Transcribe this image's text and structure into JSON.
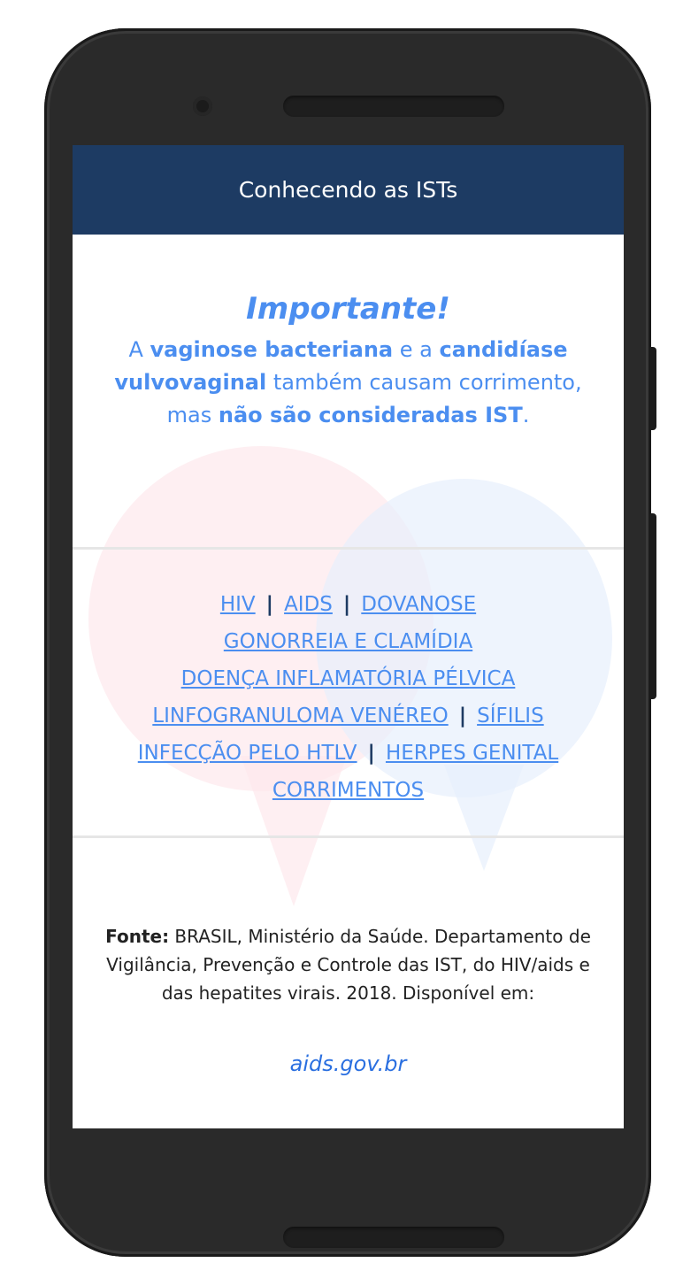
{
  "app": {
    "title": "Conhecendo as ISTs"
  },
  "notice": {
    "heading": "Importante!",
    "p1": "A ",
    "b1": "vaginose bacteriana",
    "p2": " e a ",
    "b2": "candidíase vulvovaginal",
    "p3": " também causam corrimento, mas ",
    "b3": "não são consideradas IST",
    "p4": "."
  },
  "links": {
    "hiv": "HIV",
    "aids": "AIDS",
    "dovanose": "DOVANOSE",
    "gonorreia": "GONORREIA E CLAMÍDIA",
    "dip": "DOENÇA INFLAMATÓRIA PÉLVICA",
    "linfogranuloma": "LINFOGRANULOMA VENÉREO",
    "sifilis": "SÍFILIS",
    "htlv": "INFECÇÃO PELO HTLV",
    "herpes": "HERPES GENITAL",
    "corrimentos": "CORRIMENTOS",
    "separator": "|"
  },
  "source": {
    "label": "Fonte:",
    "text": " BRASIL, Ministério da Saúde. Departamento de Vigilância, Prevenção e Controle das IST, do HIV/aids e das hepatites virais. 2018. Disponível em:",
    "link": "aids.gov.br"
  },
  "colors": {
    "appbar": "#1d3b63",
    "accent": "#4b8ef0",
    "link": "#2a6fe0"
  },
  "icons": {
    "background": "speech-bubbles-illustration"
  }
}
